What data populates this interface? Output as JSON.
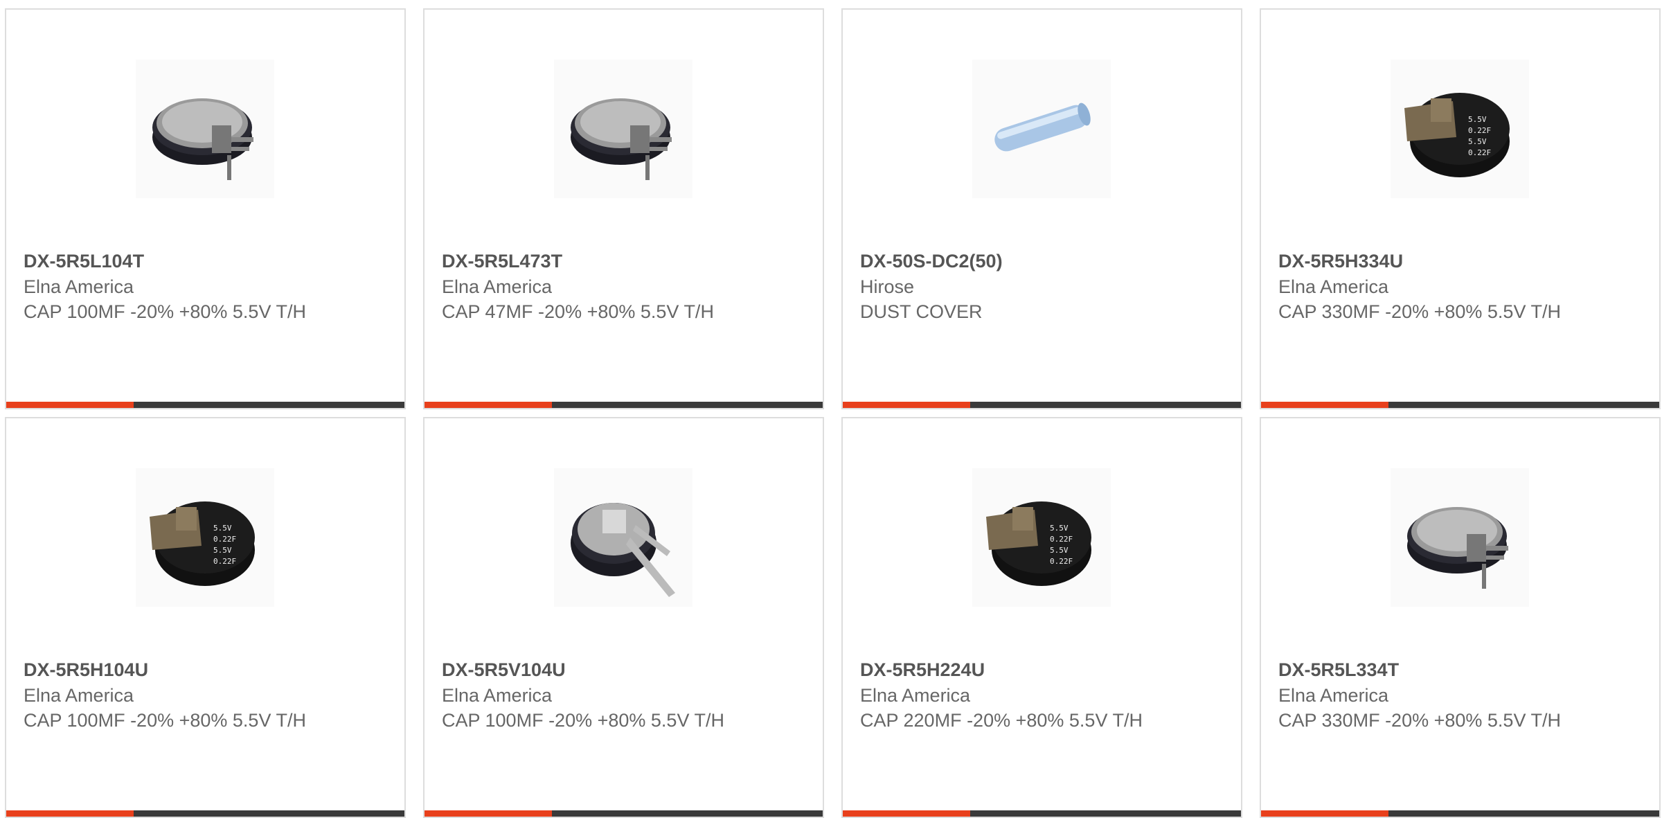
{
  "accent_color": "#e8401c",
  "bar_track_color": "#3a3a3a",
  "bar_fill_fraction": 0.32,
  "products": [
    {
      "part_number": "DX-5R5L104T",
      "manufacturer": "Elna America",
      "description": "CAP 100MF -20% +80% 5.5V T/H",
      "image": "coin-cell-capacitor-side-leads-icon"
    },
    {
      "part_number": "DX-5R5L473T",
      "manufacturer": "Elna America",
      "description": "CAP 47MF -20% +80% 5.5V T/H",
      "image": "coin-cell-capacitor-side-leads-icon"
    },
    {
      "part_number": "DX-50S-DC2(50)",
      "manufacturer": "Hirose",
      "description": "DUST COVER",
      "image": "dust-cover-tube-icon"
    },
    {
      "part_number": "DX-5R5H334U",
      "manufacturer": "Elna America",
      "description": "CAP 330MF -20% +80% 5.5V T/H",
      "image": "coin-cell-capacitor-labeled-icon"
    },
    {
      "part_number": "DX-5R5H104U",
      "manufacturer": "Elna America",
      "description": "CAP 100MF -20% +80% 5.5V T/H",
      "image": "coin-cell-capacitor-labeled-icon"
    },
    {
      "part_number": "DX-5R5V104U",
      "manufacturer": "Elna America",
      "description": "CAP 100MF -20% +80% 5.5V T/H",
      "image": "coin-cell-capacitor-vertical-leads-icon"
    },
    {
      "part_number": "DX-5R5H224U",
      "manufacturer": "Elna America",
      "description": "CAP 220MF -20% +80% 5.5V T/H",
      "image": "coin-cell-capacitor-labeled-icon"
    },
    {
      "part_number": "DX-5R5L334T",
      "manufacturer": "Elna America",
      "description": "CAP 330MF -20% +80% 5.5V T/H",
      "image": "coin-cell-capacitor-side-leads-icon"
    }
  ]
}
